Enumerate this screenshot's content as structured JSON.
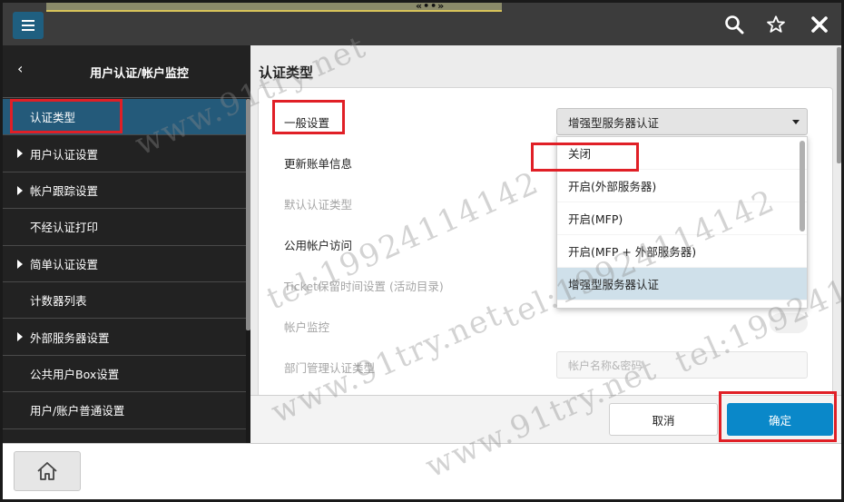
{
  "topbar": {
    "menu_icon": "hamburger-icon",
    "status_text": "«••»",
    "icons": [
      "search-icon",
      "star-icon",
      "close-icon"
    ]
  },
  "sidebar": {
    "back_icon": "chevron-left-icon",
    "back_glyph": "‹",
    "title": "用户认证/帐户监控",
    "items": [
      {
        "label": "认证类型",
        "active": true,
        "expandable": false
      },
      {
        "label": "用户认证设置",
        "active": false,
        "expandable": true
      },
      {
        "label": "帐户跟踪设置",
        "active": false,
        "expandable": true
      },
      {
        "label": "不经认证打印",
        "active": false,
        "expandable": false
      },
      {
        "label": "简单认证设置",
        "active": false,
        "expandable": true
      },
      {
        "label": "计数器列表",
        "active": false,
        "expandable": false
      },
      {
        "label": "外部服务器设置",
        "active": false,
        "expandable": true
      },
      {
        "label": "公共用户Box设置",
        "active": false,
        "expandable": false
      },
      {
        "label": "用户/账户普通设置",
        "active": false,
        "expandable": false
      }
    ]
  },
  "main": {
    "title": "认证类型",
    "rows": {
      "general": "一般设置",
      "update_billing": "更新账单信息",
      "default_auth": "默认认证类型",
      "public_access": "公用帐户访问",
      "ticket_time": "Ticket保留时间设置 (活动目录)",
      "account_monitor": "帐户监控",
      "dept_auth": "部门管理认证类型"
    },
    "general_select": {
      "value": "增强型服务器认证"
    },
    "dept_select": {
      "value": "帐户名称&密码"
    },
    "dropdown_options": [
      "关闭",
      "开启(外部服务器)",
      "开启(MFP)",
      "开启(MFP + 外部服务器)",
      "增强型服务器认证"
    ],
    "dropdown_selected_index": 4
  },
  "footer": {
    "cancel_label": "取消",
    "ok_label": "确定"
  },
  "bottombar": {
    "home_icon": "home-icon"
  },
  "watermark": {
    "site": "www.91try.net",
    "tel": "tel:19924114142"
  },
  "colors": {
    "topbar": "#3c3c3c",
    "sidebar": "#222222",
    "sidebar_active": "#245a7a",
    "primary_button": "#0a88c9",
    "highlight": "#e01f26",
    "dropdown_selected": "#cfe0ea"
  }
}
